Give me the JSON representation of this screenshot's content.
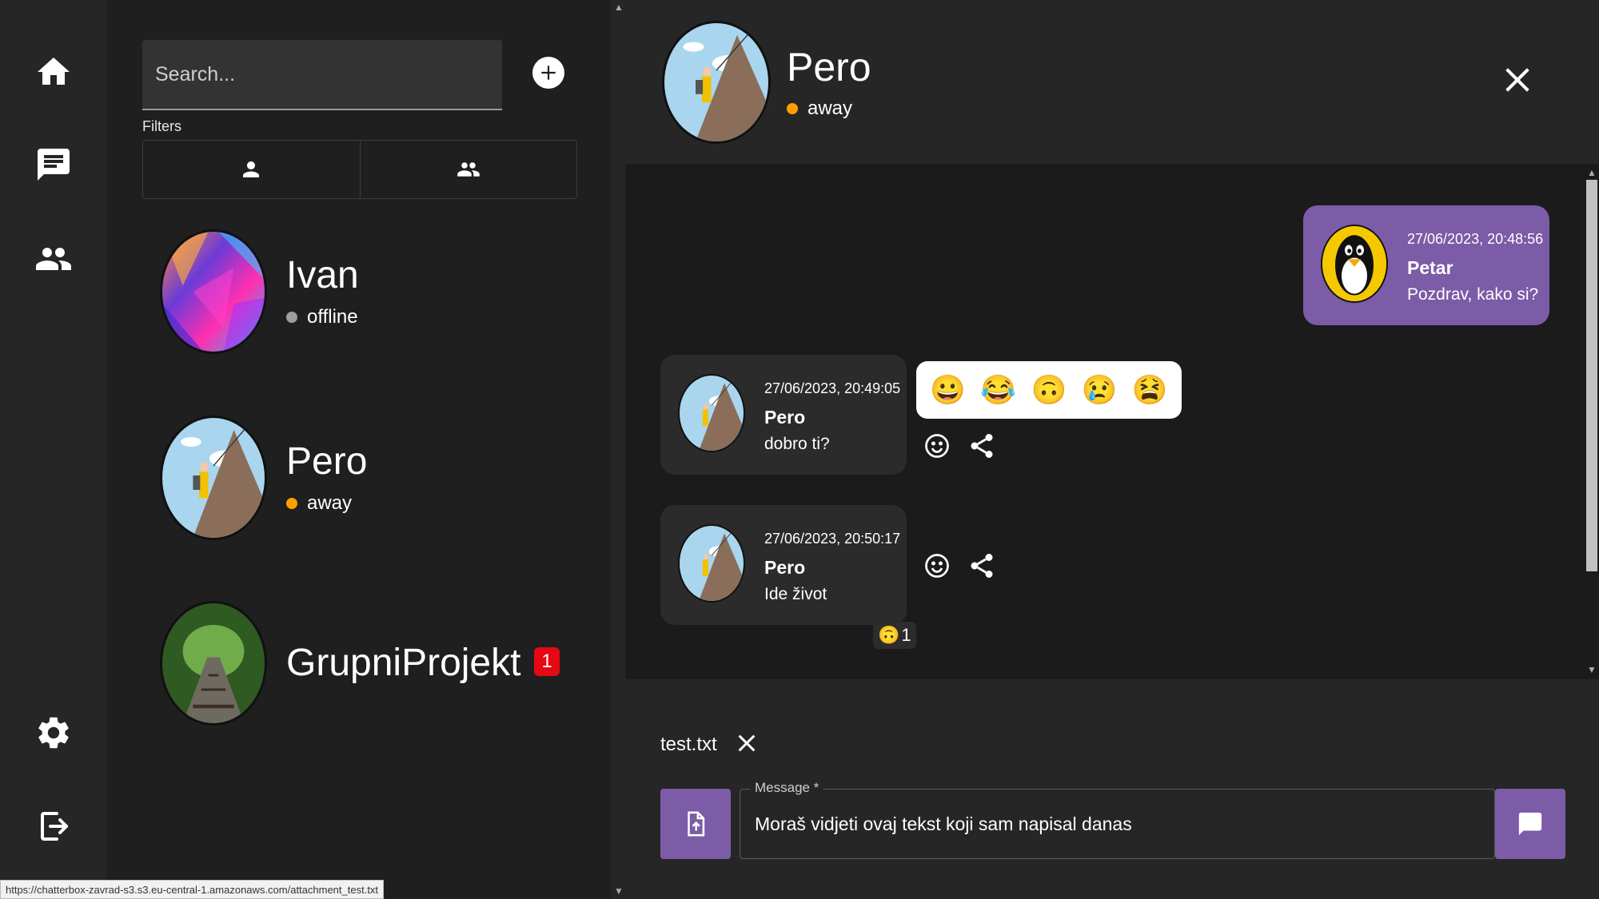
{
  "colors": {
    "accent": "#7c5ba7",
    "status_offline": "#9e9e9e",
    "status_away": "#ffa000",
    "badge": "#e50914"
  },
  "nav": {
    "items": [
      {
        "icon": "home-icon"
      },
      {
        "icon": "chat-icon"
      },
      {
        "icon": "group-icon"
      },
      {
        "icon": "settings-icon"
      },
      {
        "icon": "logout-icon"
      }
    ]
  },
  "contacts_panel": {
    "search_placeholder": "Search...",
    "filters_label": "Filters",
    "filters": [
      {
        "icon": "person-icon"
      },
      {
        "icon": "group-icon"
      }
    ],
    "contacts": [
      {
        "name": "Ivan",
        "status": "offline"
      },
      {
        "name": "Pero",
        "status": "away"
      },
      {
        "name": "GrupniProjekt",
        "unread": "1"
      }
    ]
  },
  "chat": {
    "header": {
      "name": "Pero",
      "status": "away"
    },
    "messages": [
      {
        "timestamp": "27/06/2023, 20:48:56",
        "author": "Petar",
        "text": "Pozdrav, kako si?",
        "own": true
      },
      {
        "timestamp": "27/06/2023, 20:49:05",
        "author": "Pero",
        "text": "dobro ti?"
      },
      {
        "timestamp": "27/06/2023, 20:50:17",
        "author": "Pero",
        "text": "Ide život",
        "reaction": {
          "emoji": "🙃",
          "count": "1"
        }
      }
    ],
    "emoji_picker": [
      "😀",
      "😂",
      "🙃",
      "😢",
      "😫"
    ]
  },
  "composer": {
    "attachment_name": "test.txt",
    "message_label": "Message *",
    "message_value": "Moraš vidjeti ovaj tekst koji sam napisal danas"
  },
  "browser_status_url": "https://chatterbox-zavrad-s3.s3.eu-central-1.amazonaws.com/attachment_test.txt"
}
